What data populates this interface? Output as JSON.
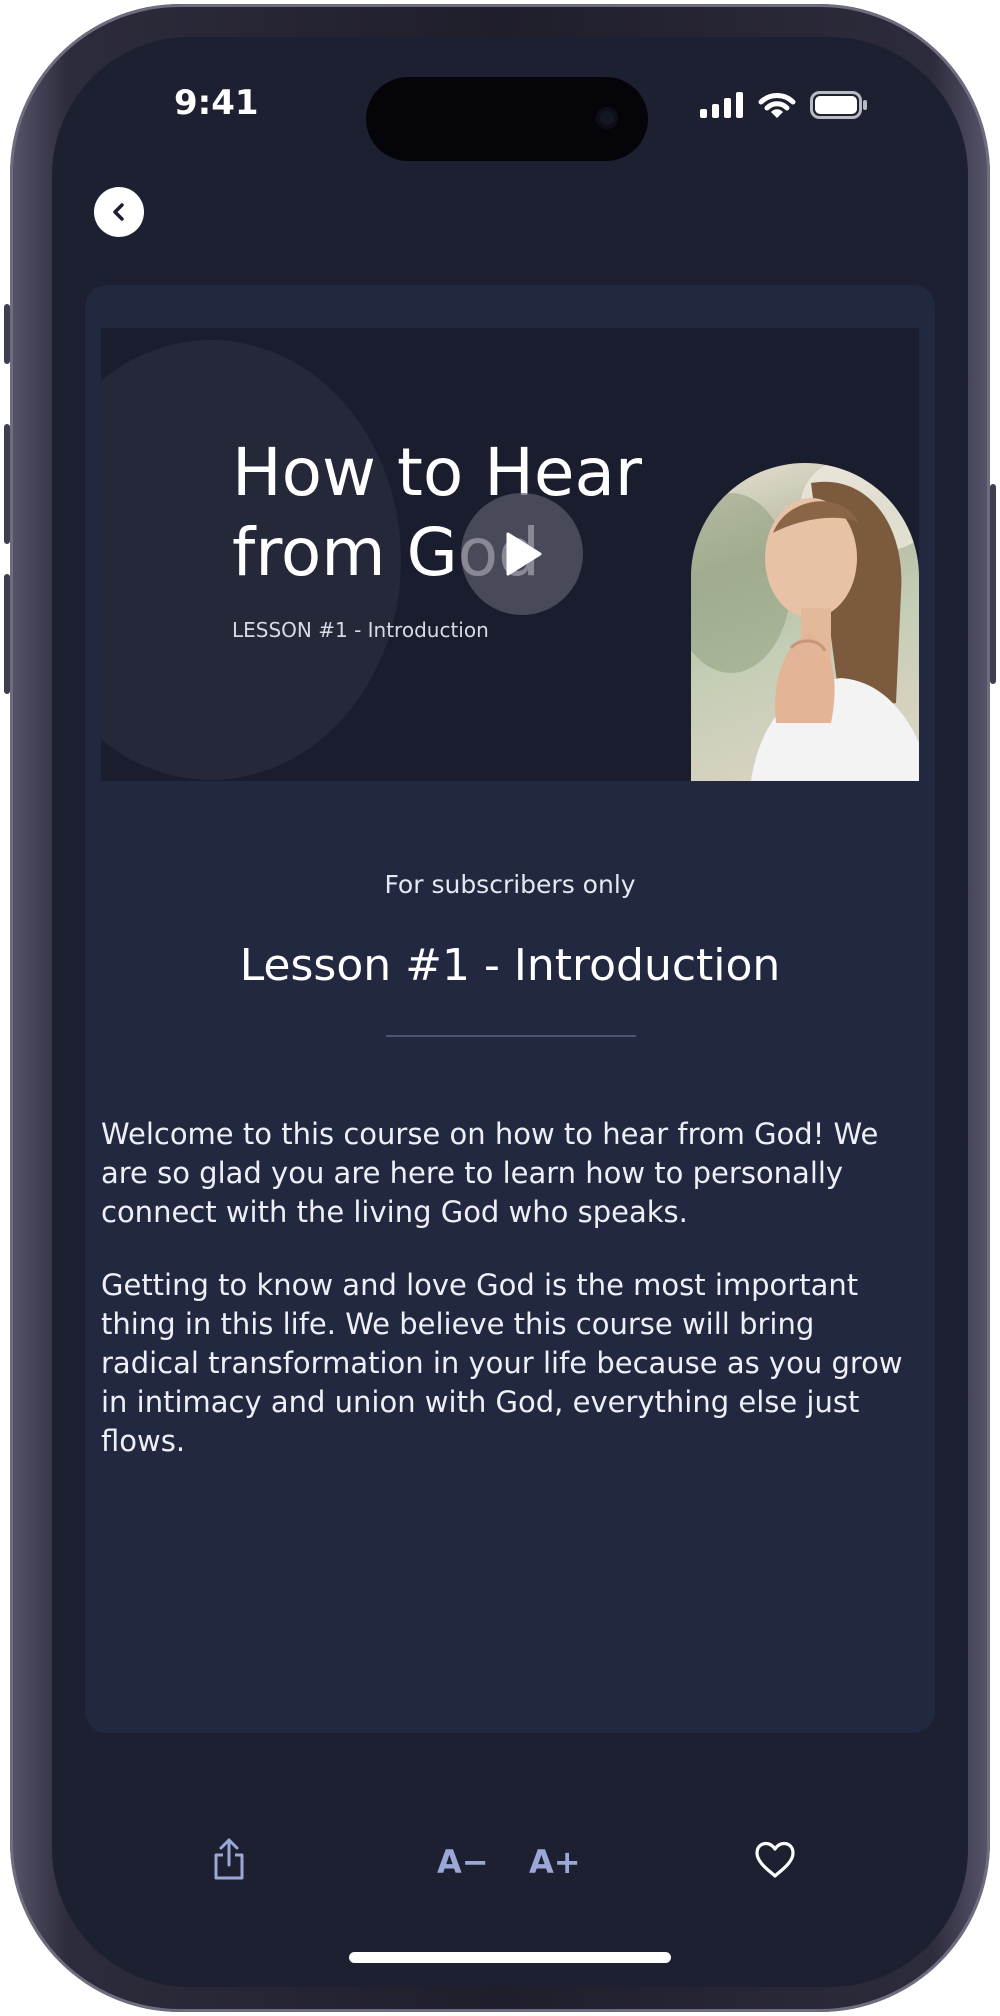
{
  "status_bar": {
    "time": "9:41"
  },
  "navigation": {
    "back_icon": "chevron-left-icon"
  },
  "video": {
    "title": "How to Hear from God",
    "subtitle": "LESSON #1 - Introduction",
    "play_icon": "play-icon"
  },
  "lesson": {
    "access_note": "For subscribers only",
    "title": "Lesson #1 - Introduction",
    "paragraphs": [
      "Welcome to this course on how to hear from God! We are so glad you are here to learn how to personally connect with the living God who speaks.",
      "Getting to know and love God is the most important thing in this life. We believe this course will bring radical transformation in your life because as you grow in intimacy and union with God, everything else just flows."
    ]
  },
  "toolbar": {
    "share_icon": "share-icon",
    "decrease_font_label": "A−",
    "increase_font_label": "A+",
    "favorite_icon": "heart-icon"
  },
  "colors": {
    "background": "#1d2031",
    "card": "#232841",
    "accent": "#9ba7d6"
  }
}
